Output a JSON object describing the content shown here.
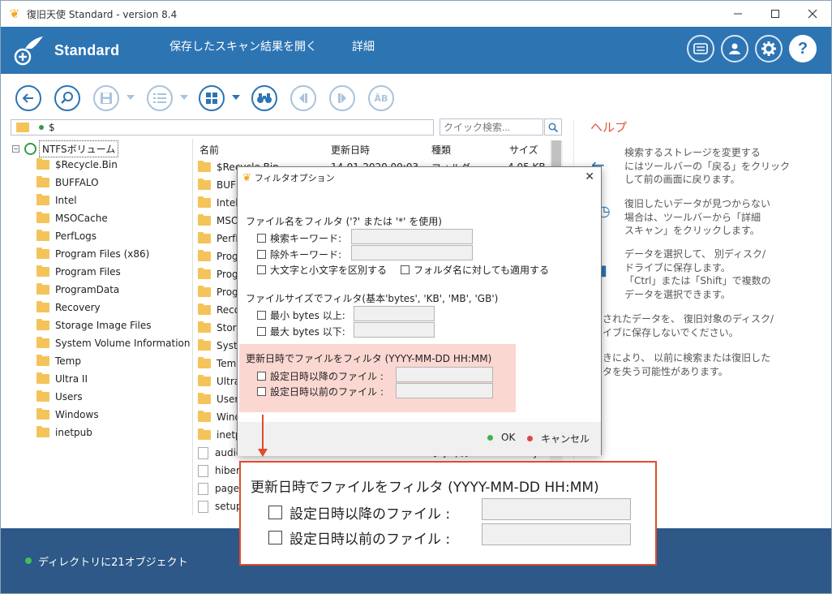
{
  "window": {
    "title": "復旧天使 Standard - version 8.4",
    "controls": [
      "minimize",
      "maximize",
      "close"
    ]
  },
  "header": {
    "brand": "Standard",
    "menu": [
      "保存したスキャン結果を開く",
      "詳細"
    ],
    "icons": [
      "license-icon",
      "account-icon",
      "gear-icon",
      "help-icon"
    ],
    "help_glyph": "?"
  },
  "toolbar": {
    "buttons": [
      "back-icon",
      "search-icon",
      "save-icon",
      "list-view-icon",
      "thumbnail-view-icon",
      "binoculars-icon",
      "prev-icon",
      "next-icon",
      "match-case-icon"
    ],
    "match_case_label": "ÄB"
  },
  "path": {
    "value": "$"
  },
  "search": {
    "placeholder": "クイック検索..."
  },
  "tree": {
    "root": "NTFSボリューム",
    "items": [
      "$Recycle.Bin",
      "BUFFALO",
      "Intel",
      "MSOCache",
      "PerfLogs",
      "Program Files (x86)",
      "Program Files",
      "ProgramData",
      "Recovery",
      "Storage Image Files",
      "System Volume Information",
      "Temp",
      "Ultra II",
      "Users",
      "Windows",
      "inetpub"
    ]
  },
  "filelist": {
    "headers": [
      "名前",
      "更新日時",
      "種類",
      "サイズ"
    ],
    "first_row": {
      "name": "$Recycle.Bin",
      "date": "14-01-2020 09:03",
      "type": "フォルダ",
      "size": "4.05 KB"
    },
    "visible_names": [
      "BUFFALO",
      "Intel",
      "MSOCache",
      "PerfLogs",
      "Prog",
      "Prog",
      "Prog",
      "Reco",
      "Stora",
      "Syste",
      "Temp",
      "Ultra",
      "Users",
      "Wind",
      "inetp",
      "audio",
      "hiber",
      "page",
      "setup"
    ],
    "partial_row": {
      "date": "14-01-2020 09:03",
      "type": "ファイル",
      "size": "6.09 bytes"
    }
  },
  "help": {
    "title": "ヘルプ",
    "paragraphs": [
      [
        "検索するストレージを変更する",
        "にはツールバーの「戻る」をクリック",
        "して前の画面に戻ります。"
      ],
      [
        "復旧したいデータが見つからない",
        "場合は、ツールバーから「詳細",
        "スキャン」をクリックします。"
      ],
      [
        "データを選択して、 別ディスク/",
        "ドライブに保存します。",
        "「Ctrl」または「Shift」で複数の",
        "データを選択できます。"
      ],
      [
        "されたデータを、 復旧対象のディスク/",
        "イブに保存しないでください。"
      ],
      [
        "きにより、 以前に検索または復旧した",
        "タを失う可能性があります。"
      ]
    ]
  },
  "footer": {
    "status": "ディレクトリに21オブジェクト"
  },
  "dialog": {
    "title": "フィルタオプション",
    "filename_section": "ファイル名をフィルタ ('?' または '*' を使用)",
    "search_keyword": "検索キーワード:",
    "exclude_keyword": "除外キーワード:",
    "case_sensitive": "大文字と小文字を区別する",
    "apply_folder": "フォルダ名に対しても適用する",
    "size_section": "ファイルサイズでフィルタ(基本'bytes', 'KB', 'MB', 'GB')",
    "min_size": "最小 bytes 以上:",
    "max_size": "最大 bytes 以下:",
    "date_section": "更新日時でファイルをフィルタ (YYYY-MM-DD HH:MM)",
    "after_date": "設定日時以降のファイル :",
    "before_date": "設定日時以前のファイル :",
    "ok": "OK",
    "cancel": "キャンセル",
    "ok_color": "#3bb44a",
    "cancel_color": "#e04545"
  },
  "zoom": {
    "title": "更新日時でファイルをフィルタ (YYYY-MM-DD HH:MM)",
    "after_date": "設定日時以降のファイル :",
    "before_date": "設定日時以前のファイル :"
  },
  "colors": {
    "brand_blue": "#2d74b3",
    "footer_blue": "#2d5887",
    "highlight": "#e24a2c",
    "pink": "#fbd7d2"
  }
}
